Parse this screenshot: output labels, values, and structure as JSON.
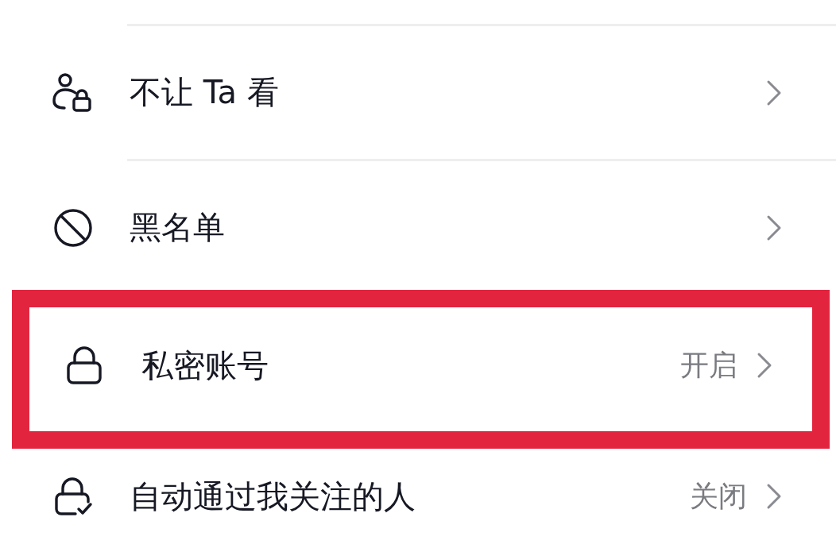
{
  "settings": [
    {
      "kind": "hide",
      "label": "不让 Ta 看",
      "highlighted": false
    },
    {
      "kind": "block",
      "label": "黑名单",
      "highlighted": false
    },
    {
      "kind": "lock",
      "label": "私密账号",
      "value": "开启",
      "highlighted": true
    },
    {
      "kind": "approve",
      "label": "自动通过我关注的人",
      "value": "关闭",
      "highlighted": false
    }
  ]
}
